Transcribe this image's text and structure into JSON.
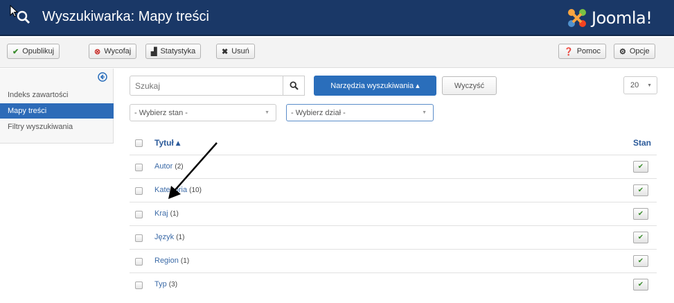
{
  "header": {
    "title": "Wyszukiwarka: Mapy treści",
    "logo_text": "Joomla!",
    "logo_colors": [
      "#f9a541",
      "#7ac143",
      "#5091cd",
      "#f44321"
    ]
  },
  "toolbar": {
    "publish_label": "Opublikuj",
    "unpublish_label": "Wycofaj",
    "stats_label": "Statystyka",
    "delete_label": "Usuń",
    "help_label": "Pomoc",
    "options_label": "Opcje"
  },
  "sidebar": {
    "items": [
      {
        "label": "Indeks zawartości",
        "active": false
      },
      {
        "label": "Mapy treści",
        "active": true
      },
      {
        "label": "Filtry wyszukiwania",
        "active": false
      }
    ]
  },
  "filters": {
    "search_placeholder": "Szukaj",
    "tools_label": "Narzędzia wyszukiwania ▴",
    "clear_label": "Wyczyść",
    "limit_value": "20",
    "state_select": "- Wybierz stan -",
    "branch_select": "- Wybierz dział -"
  },
  "table": {
    "title_header": "Tytuł ▴",
    "state_header": "Stan",
    "rows": [
      {
        "title": "Autor",
        "count": "(2)"
      },
      {
        "title": "Kategoria",
        "count": "(10)"
      },
      {
        "title": "Kraj",
        "count": "(1)"
      },
      {
        "title": "Język",
        "count": "(1)"
      },
      {
        "title": "Region",
        "count": "(1)"
      },
      {
        "title": "Typ",
        "count": "(3)"
      }
    ]
  },
  "colors": {
    "header_bg": "#1a3867",
    "primary": "#2a6ebb",
    "check_green": "#3c8d2f",
    "danger_red": "#c9302c"
  }
}
